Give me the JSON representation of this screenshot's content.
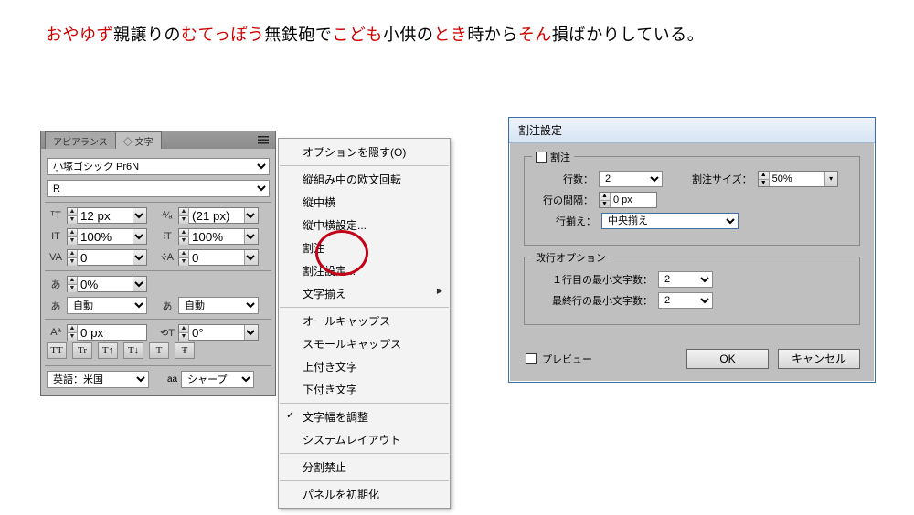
{
  "sample_sentence": {
    "parts": [
      {
        "t": "おやゆず",
        "red": true
      },
      {
        "t": "親譲りの",
        "red": false
      },
      {
        "t": "むてっぽう",
        "red": true
      },
      {
        "t": "無鉄砲で",
        "red": false
      },
      {
        "t": "こども",
        "red": true
      },
      {
        "t": "小供の",
        "red": false
      },
      {
        "t": "とき",
        "red": true
      },
      {
        "t": "時から",
        "red": false
      },
      {
        "t": "そん",
        "red": true
      },
      {
        "t": "損ばかりしている。",
        "red": false
      }
    ]
  },
  "panel": {
    "tabs": {
      "appearance": "アピアランス",
      "character": "文字"
    },
    "font_family": "小塚ゴシック Pr6N",
    "font_style": "R",
    "font_size": "12 px",
    "leading": "(21 px)",
    "vscale": "100%",
    "hscale": "100%",
    "kerning": "0",
    "tracking": "0",
    "prop": "0%",
    "aki_left": "自動",
    "aki_right": "自動",
    "baseline": "0 px",
    "rotation": "0°",
    "ot_icons": [
      "TT",
      "Tr",
      "T↑",
      "T↓",
      "T",
      "Ŧ"
    ],
    "lang": "英語：米国",
    "aa_label": "aa",
    "aa_value": "シャープ"
  },
  "menu": {
    "hide": "オプションを隠す(O)",
    "tatechuyoko_rot": "縦組み中の欧文回転",
    "tatechuyoko": "縦中横",
    "tatechuyoko_set": "縦中横設定...",
    "warichu": "割注",
    "warichu_set": "割注設定...",
    "moji_soroe": "文字揃え",
    "allcaps": "オールキャップス",
    "smallcaps": "スモールキャップス",
    "super": "上付き文字",
    "sub": "下付き文字",
    "fit_width": "文字幅を調整",
    "system_layout": "システムレイアウト",
    "nobreak": "分割禁止",
    "reset": "パネルを初期化"
  },
  "dialog": {
    "title": "割注設定",
    "group_warichu": "割注",
    "lines_label": "行数：",
    "lines_value": "2",
    "size_label": "割注サイズ：",
    "size_value": "50%",
    "gap_label": "行の間隔：",
    "gap_value": "0 px",
    "align_label": "行揃え：",
    "align_value": "中央揃え",
    "group_break": "改行オプション",
    "min_first_label": "１行目の最小文字数：",
    "min_first_value": "2",
    "min_last_label": "最終行の最小文字数：",
    "min_last_value": "2",
    "preview": "プレビュー",
    "ok": "OK",
    "cancel": "キャンセル"
  }
}
